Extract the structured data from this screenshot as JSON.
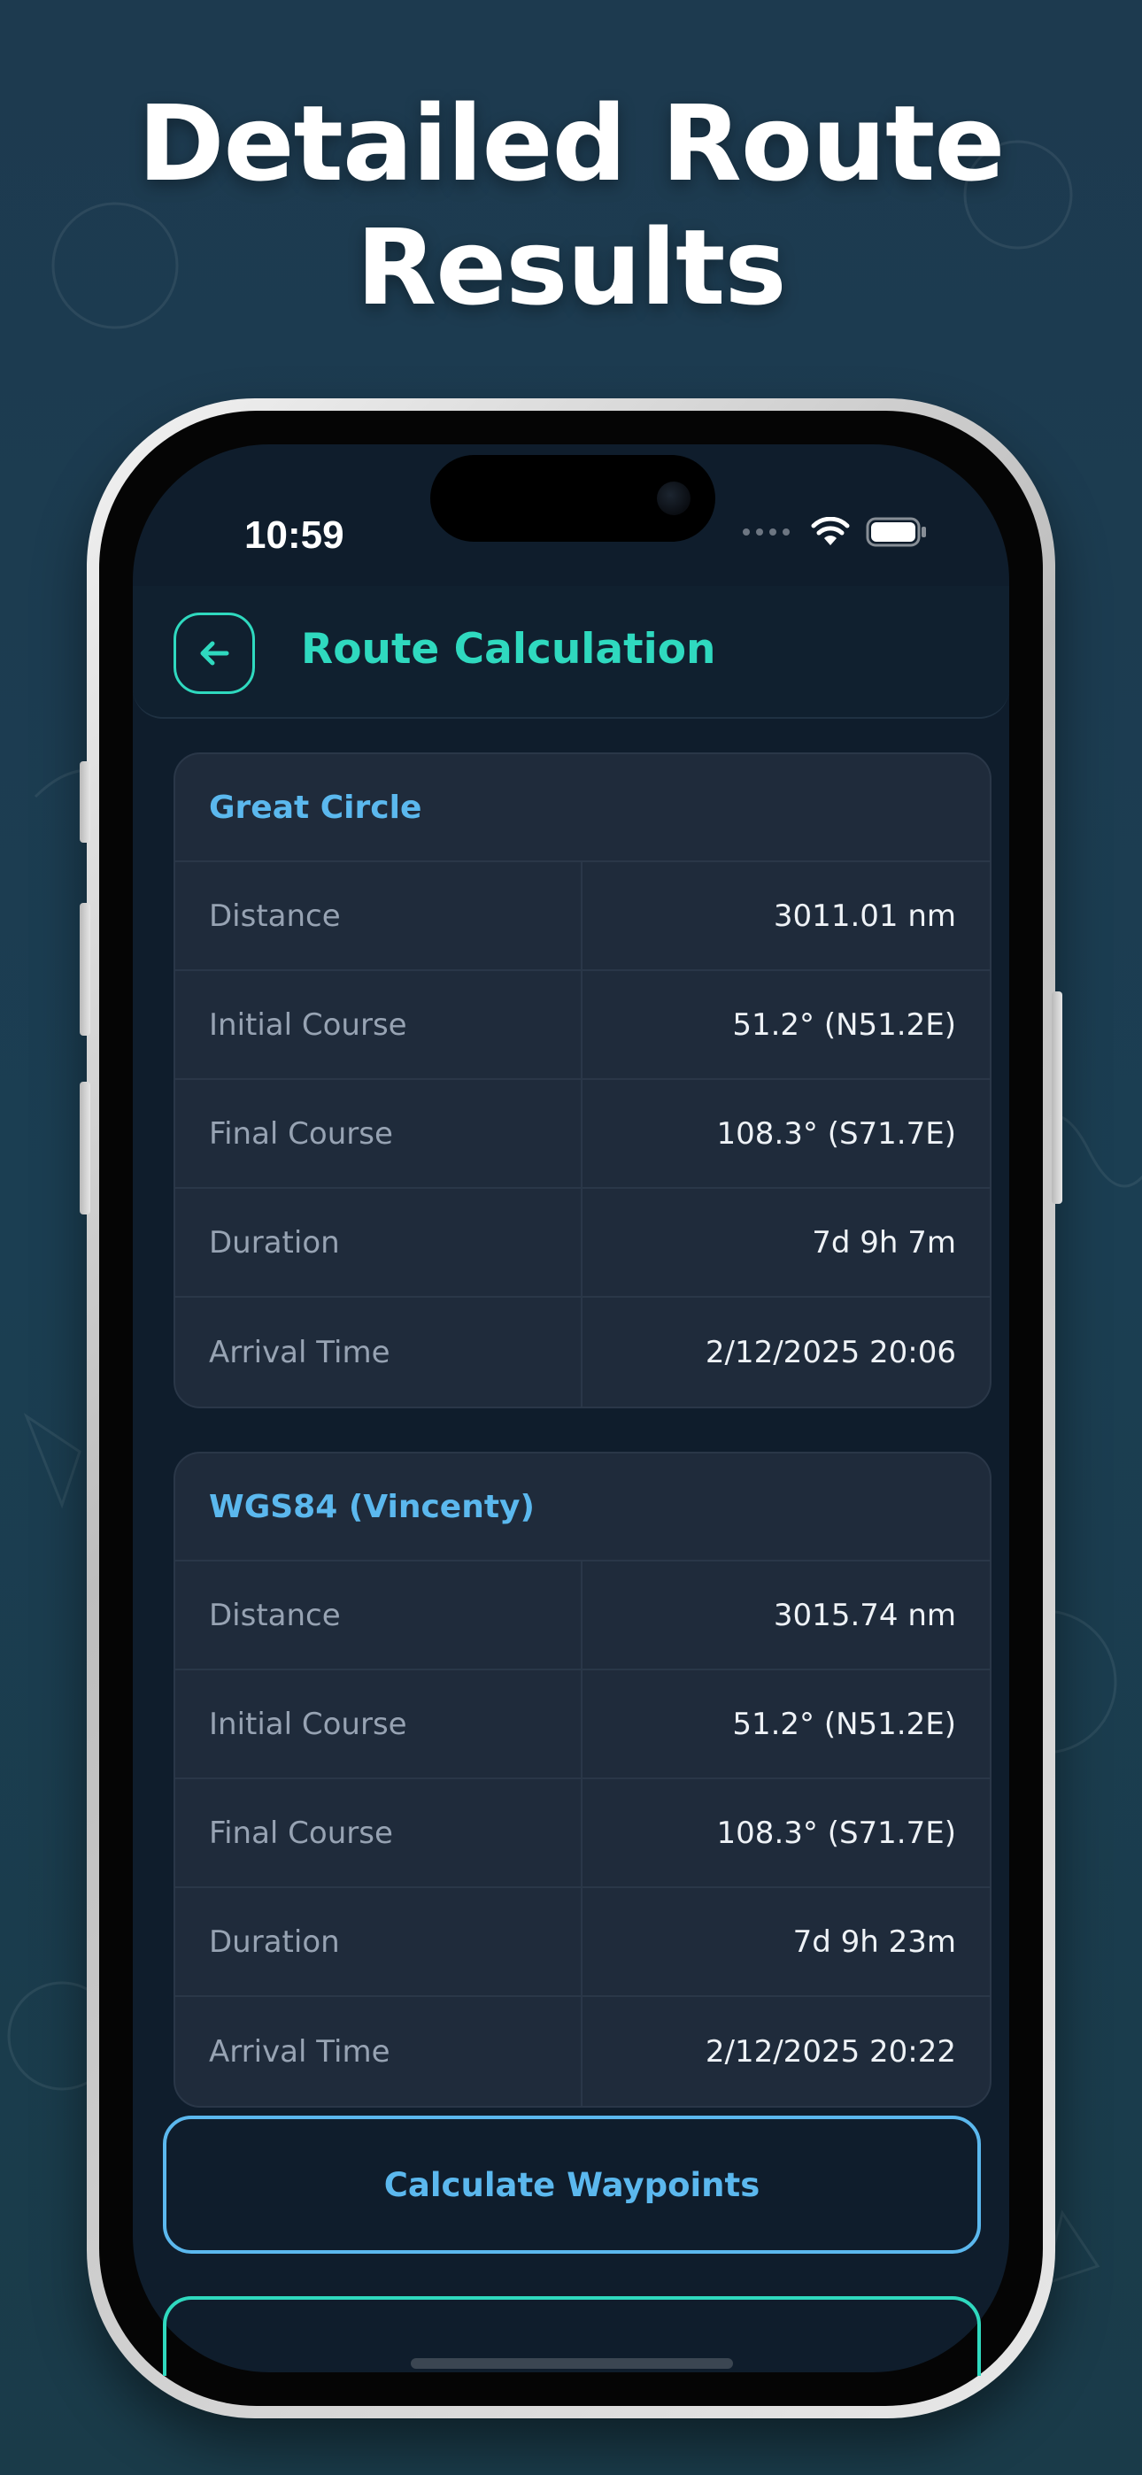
{
  "headline": {
    "line1": "Detailed Route",
    "line2": "Results"
  },
  "status_bar": {
    "time": "10:59",
    "icons": [
      "signal-dots-icon",
      "wifi-icon",
      "battery-icon"
    ]
  },
  "header": {
    "back_icon": "arrow-left-icon",
    "title": "Route Calculation"
  },
  "colors": {
    "accent_teal": "#2fd9bf",
    "accent_blue": "#5bb8ee",
    "card_bg": "#1f2b3b",
    "screen_bg": "#0f1d2c"
  },
  "cards": [
    {
      "title": "Great Circle",
      "rows": [
        {
          "label": "Distance",
          "value": "3011.01 nm"
        },
        {
          "label": "Initial Course",
          "value": "51.2° (N51.2E)"
        },
        {
          "label": "Final Course",
          "value": "108.3° (S71.7E)"
        },
        {
          "label": "Duration",
          "value": "7d 9h 7m"
        },
        {
          "label": "Arrival Time",
          "value": "2/12/2025 20:06"
        }
      ]
    },
    {
      "title": "WGS84 (Vincenty)",
      "rows": [
        {
          "label": "Distance",
          "value": "3015.74 nm"
        },
        {
          "label": "Initial Course",
          "value": "51.2° (N51.2E)"
        },
        {
          "label": "Final Course",
          "value": "108.3° (S71.7E)"
        },
        {
          "label": "Duration",
          "value": "7d 9h 23m"
        },
        {
          "label": "Arrival Time",
          "value": "2/12/2025 20:22"
        }
      ]
    }
  ],
  "buttons": {
    "calculate_waypoints": "Calculate Waypoints"
  }
}
